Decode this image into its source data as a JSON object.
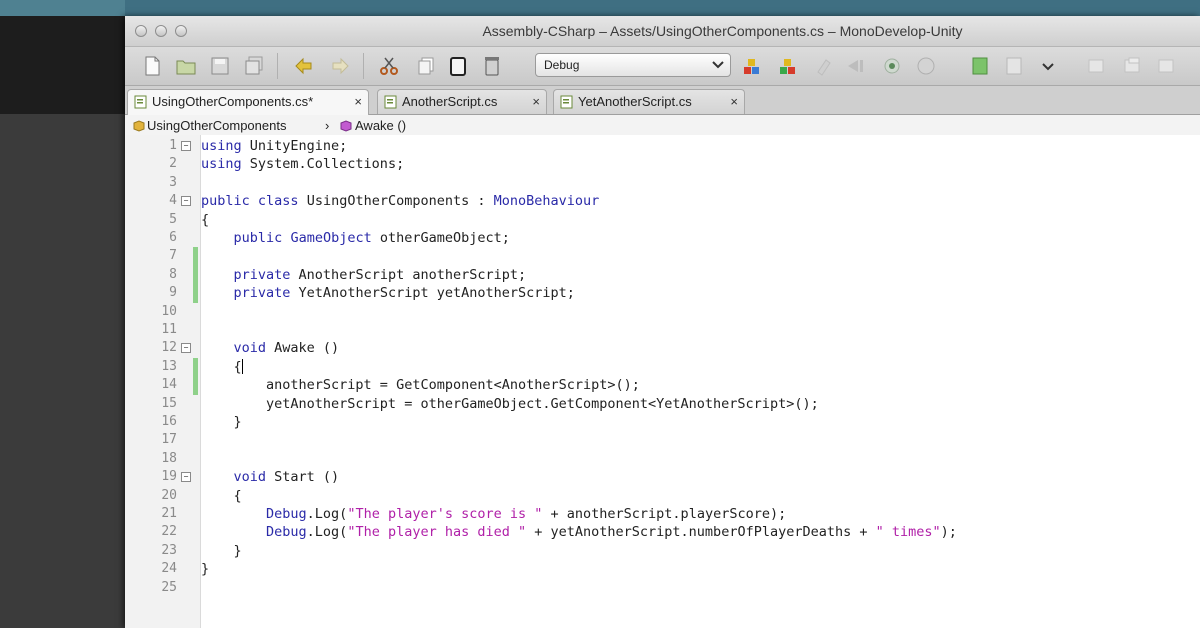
{
  "window": {
    "title": "Assembly-CSharp – Assets/UsingOtherComponents.cs – MonoDevelop-Unity"
  },
  "toolbar": {
    "configuration": "Debug",
    "icons": [
      "new-file-icon",
      "open-folder-icon",
      "save-icon",
      "save-all-icon",
      "undo-icon",
      "redo-icon",
      "cut-icon",
      "copy-icon",
      "paste-icon",
      "delete-icon",
      "build-icon",
      "run-icon",
      "attach-icon",
      "step-icon",
      "breakpoint-icon",
      "stop-icon",
      "view-icon",
      "layout-icon",
      "dropdown-icon",
      "window-icon-1",
      "window-icon-2",
      "window-icon-3"
    ]
  },
  "tabs": [
    {
      "label": "UsingOtherComponents.cs*",
      "close": "×",
      "active": true
    },
    {
      "label": "AnotherScript.cs",
      "close": "×",
      "active": false
    },
    {
      "label": "YetAnotherScript.cs",
      "close": "×",
      "active": false
    }
  ],
  "breadcrumb": {
    "class_name": "UsingOtherComponents",
    "separator": "›",
    "method_name": "Awake ()"
  },
  "code": {
    "line_numbers": [
      "1",
      "2",
      "3",
      "4",
      "5",
      "6",
      "7",
      "8",
      "9",
      "10",
      "11",
      "12",
      "13",
      "14",
      "15",
      "16",
      "17",
      "18",
      "19",
      "20",
      "21",
      "22",
      "23",
      "24",
      "25"
    ],
    "lines": [
      [
        [
          "kw",
          "using"
        ],
        [
          "p",
          " UnityEngine;"
        ]
      ],
      [
        [
          "kw",
          "using"
        ],
        [
          "p",
          " System.Collections;"
        ]
      ],
      [],
      [
        [
          "kw",
          "public"
        ],
        [
          "p",
          " "
        ],
        [
          "kw",
          "class"
        ],
        [
          "p",
          " UsingOtherComponents : "
        ],
        [
          "ty",
          "MonoBehaviour"
        ]
      ],
      [
        [
          "p",
          "{"
        ]
      ],
      [
        [
          "p",
          "    "
        ],
        [
          "kw",
          "public"
        ],
        [
          "p",
          " "
        ],
        [
          "ty",
          "GameObject"
        ],
        [
          "p",
          " otherGameObject;"
        ]
      ],
      [],
      [
        [
          "p",
          "    "
        ],
        [
          "kw",
          "private"
        ],
        [
          "p",
          " AnotherScript anotherScript;"
        ]
      ],
      [
        [
          "p",
          "    "
        ],
        [
          "kw",
          "private"
        ],
        [
          "p",
          " YetAnotherScript yetAnotherScript;"
        ]
      ],
      [],
      [],
      [
        [
          "p",
          "    "
        ],
        [
          "kw",
          "void"
        ],
        [
          "p",
          " Awake ()"
        ]
      ],
      [
        [
          "p",
          "    {"
        ]
      ],
      [
        [
          "p",
          "        anotherScript = GetComponent<AnotherScript>();"
        ]
      ],
      [
        [
          "p",
          "        yetAnotherScript = otherGameObject.GetComponent<YetAnotherScript>();"
        ]
      ],
      [
        [
          "p",
          "    }"
        ]
      ],
      [],
      [],
      [
        [
          "p",
          "    "
        ],
        [
          "kw",
          "void"
        ],
        [
          "p",
          " Start ()"
        ]
      ],
      [
        [
          "p",
          "    {"
        ]
      ],
      [
        [
          "p",
          "        "
        ],
        [
          "ty",
          "Debug"
        ],
        [
          "p",
          ".Log("
        ],
        [
          "str",
          "\"The player's score is \""
        ],
        [
          "p",
          " + anotherScript.playerScore);"
        ]
      ],
      [
        [
          "p",
          "        "
        ],
        [
          "ty",
          "Debug"
        ],
        [
          "p",
          ".Log("
        ],
        [
          "str",
          "\"The player has died \""
        ],
        [
          "p",
          " + yetAnotherScript.numberOfPlayerDeaths + "
        ],
        [
          "str",
          "\" times\""
        ],
        [
          "p",
          ");"
        ]
      ],
      [
        [
          "p",
          "    }"
        ]
      ],
      [
        [
          "p",
          "}"
        ]
      ],
      []
    ],
    "fold_lines": [
      1,
      4,
      12,
      19
    ],
    "fold_symbol": "−",
    "modified_lines": [
      7,
      8,
      9,
      13,
      14
    ],
    "caret_line": 13
  }
}
